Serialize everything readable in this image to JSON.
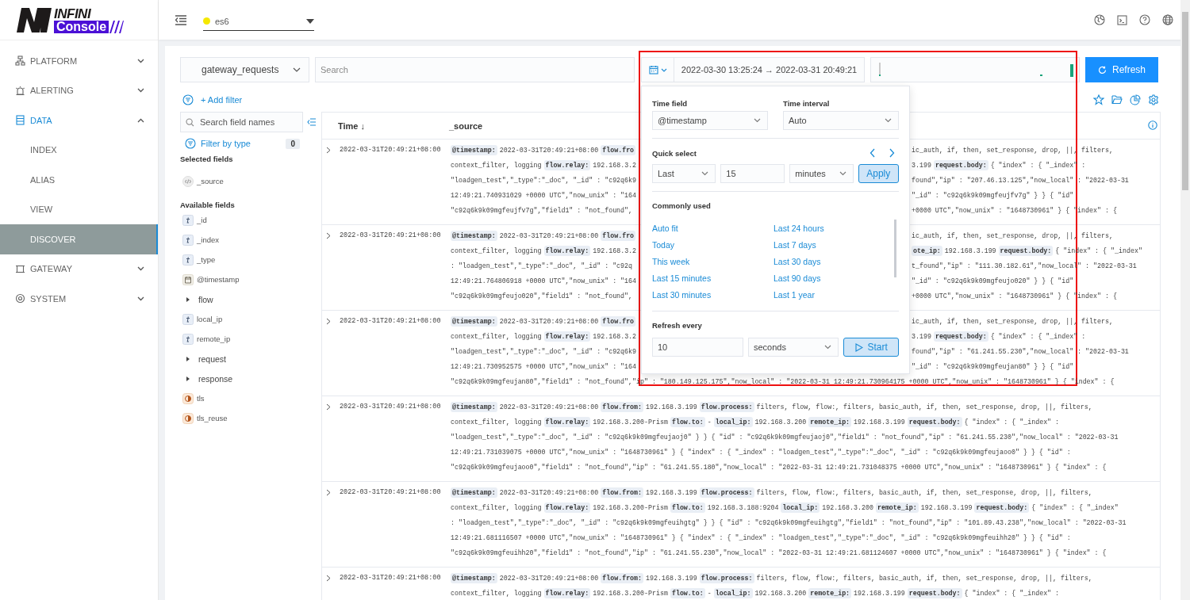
{
  "logo": {
    "brand": "INFINI",
    "product": "Console"
  },
  "nav": [
    {
      "label": "PLATFORM",
      "selected": false,
      "expanded": false
    },
    {
      "label": "ALERTING",
      "selected": false,
      "expanded": false
    },
    {
      "label": "DATA",
      "selected": true,
      "expanded": true,
      "children": [
        {
          "label": "INDEX",
          "selected": false
        },
        {
          "label": "ALIAS",
          "selected": false
        },
        {
          "label": "VIEW",
          "selected": false
        },
        {
          "label": "DISCOVER",
          "selected": true
        }
      ]
    },
    {
      "label": "GATEWAY",
      "selected": false,
      "expanded": false
    },
    {
      "label": "SYSTEM",
      "selected": false,
      "expanded": false
    }
  ],
  "cluster": {
    "name": "es6",
    "color": "#f5e800"
  },
  "toolbar": {
    "index": "gateway_requests",
    "search_placeholder": "Search",
    "time_range": "2022-03-30 13:25:24 → 2022-03-31 20:49:21",
    "refresh": "Refresh",
    "add_filter": "+ Add filter"
  },
  "fields": {
    "search_placeholder": "Search field names",
    "filter_label": "Filter by type",
    "filter_count": "0",
    "selected_title": "Selected fields",
    "selected": [
      {
        "name": "_source",
        "kind": "source"
      }
    ],
    "available_title": "Available fields",
    "available": [
      {
        "name": "_id",
        "kind": "string"
      },
      {
        "name": "_index",
        "kind": "string"
      },
      {
        "name": "_type",
        "kind": "string"
      },
      {
        "name": "@timestamp",
        "kind": "date"
      },
      {
        "name": "flow",
        "kind": "group"
      },
      {
        "name": "local_ip",
        "kind": "string"
      },
      {
        "name": "remote_ip",
        "kind": "string"
      },
      {
        "name": "request",
        "kind": "group"
      },
      {
        "name": "response",
        "kind": "group"
      },
      {
        "name": "tls",
        "kind": "boolean"
      },
      {
        "name": "tls_reuse",
        "kind": "boolean"
      }
    ]
  },
  "table": {
    "columns": [
      "Time ↓",
      "_source"
    ],
    "rows": [
      {
        "time": "2022-03-31T20:49:21+08:00",
        "lines": [
          {
            "kind": "split",
            "left": [
              {
                "key": "@timestamp:"
              },
              {
                "value": "2022-03-31T20:49:21+08:00"
              },
              {
                "key": "flow.fro"
              }
            ],
            "right": [
              {
                "value": "ic_auth, if, then, set_response, drop, ||, filters,"
              }
            ]
          },
          {
            "kind": "split",
            "left": [
              {
                "value": "context_filter, logging"
              },
              {
                "key": "flow.relay:"
              },
              {
                "value": "192.168.3.2"
              }
            ],
            "right": [
              {
                "value": "3.199"
              },
              {
                "key": "request.body:"
              },
              {
                "value": "{ \"index\" : { \"_index\" :"
              }
            ]
          },
          {
            "kind": "split",
            "left": [
              {
                "value": "\"loadgen_test\",\"_type\":\"_doc\", \"_id\" : \"c92q6k9"
              }
            ],
            "right": [
              {
                "value": "found\",\"ip\" : \"207.46.13.125\",\"now_local\" : \"2022-03-31"
              }
            ]
          },
          {
            "kind": "split",
            "left": [
              {
                "value": "12:49:21.740931029 +0000 UTC\",\"now_unix\" : \"164"
              }
            ],
            "right": [
              {
                "value": "\"_id\" : \"c92q6k9k09mgfeujfv7g\" } } { \"id\""
              }
            ]
          },
          {
            "kind": "split",
            "left": [
              {
                "value": "\"c92q6k9k09mgfeujfv7g\",\"field1\" : \"not_found\","
              }
            ],
            "right": [
              {
                "value": "+0000 UTC\",\"now_unix\" : \"1648730961\" } { \"index\" : {"
              }
            ]
          }
        ]
      },
      {
        "time": "2022-03-31T20:49:21+08:00",
        "lines": [
          {
            "kind": "split",
            "left": [
              {
                "key": "@timestamp:"
              },
              {
                "value": "2022-03-31T20:49:21+08:00"
              },
              {
                "key": "flow.fro"
              }
            ],
            "right": [
              {
                "value": "ic_auth, if, then, set_response, drop, ||, filters,"
              }
            ]
          },
          {
            "kind": "split",
            "left": [
              {
                "value": "context_filter, logging"
              },
              {
                "key": "flow.relay:"
              },
              {
                "value": "192.168.3.2"
              }
            ],
            "right": [
              {
                "key": "ote_ip:"
              },
              {
                "value": "192.168.3.199"
              },
              {
                "key": "request.body:"
              },
              {
                "value": "{ \"index\" : { \"_index\""
              }
            ]
          },
          {
            "kind": "split",
            "left": [
              {
                "value": ": \"loadgen_test\",\"_type\":\"_doc\", \"_id\" : \"c92q"
              }
            ],
            "right": [
              {
                "value": "t_found\",\"ip\" : \"111.30.182.61\",\"now_local\" : \"2022-03-31"
              }
            ]
          },
          {
            "kind": "split",
            "left": [
              {
                "value": "12:49:21.764806918 +0000 UTC\",\"now_unix\" : \"164"
              }
            ],
            "right": [
              {
                "value": "\"_id\" : \"c92q6k9k09mgfeujo020\" } } { \"id\""
              }
            ]
          },
          {
            "kind": "split",
            "left": [
              {
                "value": "\"c92q6k9k09mgfeujo020\",\"field1\" : \"not_found\","
              }
            ],
            "right": [
              {
                "value": "+0000 UTC\",\"now_unix\" : \"1648730961\" } { \"index\" : {"
              }
            ]
          }
        ]
      },
      {
        "time": "2022-03-31T20:49:21+08:00",
        "lines": [
          {
            "kind": "split",
            "left": [
              {
                "key": "@timestamp:"
              },
              {
                "value": "2022-03-31T20:49:21+08:00"
              },
              {
                "key": "flow.fro"
              }
            ],
            "right": [
              {
                "value": "ic_auth, if, then, set_response, drop, ||, filters,"
              }
            ]
          },
          {
            "kind": "split",
            "left": [
              {
                "value": "context_filter, logging"
              },
              {
                "key": "flow.relay:"
              },
              {
                "value": "192.168.3.2"
              }
            ],
            "right": [
              {
                "value": "3.199"
              },
              {
                "key": "request.body:"
              },
              {
                "value": "{ \"index\" : { \"_index\" :"
              }
            ]
          },
          {
            "kind": "split",
            "left": [
              {
                "value": "\"loadgen_test\",\"_type\":\"_doc\", \"_id\" : \"c92q6k9"
              }
            ],
            "right": [
              {
                "value": "found\",\"ip\" : \"61.241.55.230\",\"now_local\" : \"2022-03-31"
              }
            ]
          },
          {
            "kind": "split",
            "left": [
              {
                "value": "12:49:21.730952575 +0000 UTC\",\"now_unix\" : \"164"
              }
            ],
            "right": [
              {
                "value": "\"_id\" : \"c92q6k9k09mgfeujan80\" } } { \"id\""
              }
            ]
          },
          {
            "kind": "full",
            "segments": [
              {
                "value": "\"c92q6k9k09mgfeujan80\",\"field1\" : \"not_found\",\"ip\" : \"180.149.125.175\",\"now_local\" : \"2022-03-31 12:49:21.730964175 +0000 UTC\",\"now_unix\" : \"1648730961\" } { \"index\" : {"
              }
            ]
          }
        ]
      },
      {
        "time": "2022-03-31T20:49:21+08:00",
        "lines": [
          {
            "kind": "full",
            "segments": [
              {
                "key": "@timestamp:"
              },
              {
                "value": "2022-03-31T20:49:21+08:00"
              },
              {
                "key": "flow.from:"
              },
              {
                "value": "192.168.3.199"
              },
              {
                "key": "flow.process:"
              },
              {
                "value": "filters, flow, flow:, filters, basic_auth, if, then, set_response, drop, ||, filters,"
              }
            ]
          },
          {
            "kind": "full",
            "segments": [
              {
                "value": "context_filter, logging"
              },
              {
                "key": "flow.relay:"
              },
              {
                "value": "192.168.3.200-Prism"
              },
              {
                "key": "flow.to:"
              },
              {
                "value": "-"
              },
              {
                "key": "local_ip:"
              },
              {
                "value": "192.168.3.200"
              },
              {
                "key": "remote_ip:"
              },
              {
                "value": "192.168.3.199"
              },
              {
                "key": "request.body:"
              },
              {
                "value": "{ \"index\" : { \"_index\" :"
              }
            ]
          },
          {
            "kind": "full",
            "segments": [
              {
                "value": "\"loadgen_test\",\"_type\":\"_doc\", \"_id\" : \"c92q6k9k09mgfeujaoj0\" } } { \"id\" : \"c92q6k9k09mgfeujaoj0\",\"field1\" : \"not_found\",\"ip\" : \"61.241.55.230\",\"now_local\" : \"2022-03-31"
              }
            ]
          },
          {
            "kind": "full",
            "segments": [
              {
                "value": "12:49:21.731039075 +0000 UTC\",\"now_unix\" : \"1648730961\" } { \"index\" : { \"_index\" : \"loadgen_test\",\"_type\":\"_doc\", \"_id\" : \"c92q6k9k09mgfeujaoo0\" } } { \"id\" :"
              }
            ]
          },
          {
            "kind": "full",
            "segments": [
              {
                "value": "\"c92q6k9k09mgfeujaoo0\",\"field1\" : \"not_found\",\"ip\" : \"61.241.55.180\",\"now_local\" : \"2022-03-31 12:49:21.731048375 +0000 UTC\",\"now_unix\" : \"1648730961\" } { \"index\" : {"
              }
            ]
          }
        ]
      },
      {
        "time": "2022-03-31T20:49:21+08:00",
        "lines": [
          {
            "kind": "full",
            "segments": [
              {
                "key": "@timestamp:"
              },
              {
                "value": "2022-03-31T20:49:21+08:00"
              },
              {
                "key": "flow.from:"
              },
              {
                "value": "192.168.3.199"
              },
              {
                "key": "flow.process:"
              },
              {
                "value": "filters, flow, flow:, filters, basic_auth, if, then, set_response, drop, ||, filters,"
              }
            ]
          },
          {
            "kind": "full",
            "segments": [
              {
                "value": "context_filter, logging"
              },
              {
                "key": "flow.relay:"
              },
              {
                "value": "192.168.3.200-Prism"
              },
              {
                "key": "flow.to:"
              },
              {
                "value": "192.168.3.188:9204"
              },
              {
                "key": "local_ip:"
              },
              {
                "value": "192.168.3.200"
              },
              {
                "key": "remote_ip:"
              },
              {
                "value": "192.168.3.199"
              },
              {
                "key": "request.body:"
              },
              {
                "value": "{ \"index\" : { \"_index\""
              }
            ]
          },
          {
            "kind": "full",
            "segments": [
              {
                "value": ": \"loadgen_test\",\"_type\":\"_doc\", \"_id\" : \"c92q6k9k09mgfeuihgtg\" } } { \"id\" : \"c92q6k9k09mgfeuihgtg\",\"field1\" : \"not_found\",\"ip\" : \"101.89.43.238\",\"now_local\" : \"2022-03-31"
              }
            ]
          },
          {
            "kind": "full",
            "segments": [
              {
                "value": "12:49:21.681116507 +0000 UTC\",\"now_unix\" : \"1648730961\" } { \"index\" : { \"_index\" : \"loadgen_test\",\"_type\":\"_doc\", \"_id\" : \"c92q6k9k09mgfeuihh20\" } } { \"id\" :"
              }
            ]
          },
          {
            "kind": "full",
            "segments": [
              {
                "value": "\"c92q6k9k09mgfeuihh20\",\"field1\" : \"not_found\",\"ip\" : \"61.241.55.230\",\"now_local\" : \"2022-03-31 12:49:21.681124607 +0000 UTC\",\"now_unix\" : \"1648730961\" } { \"index\" : {"
              }
            ]
          }
        ]
      },
      {
        "time": "2022-03-31T20:49:21+08:00",
        "lines": [
          {
            "kind": "full",
            "segments": [
              {
                "key": "@timestamp:"
              },
              {
                "value": "2022-03-31T20:49:21+08:00"
              },
              {
                "key": "flow.from:"
              },
              {
                "value": "192.168.3.199"
              },
              {
                "key": "flow.process:"
              },
              {
                "value": "filters, flow, flow:, filters, basic_auth, if, then, set_response, drop, ||, filters,"
              }
            ]
          },
          {
            "kind": "full",
            "segments": [
              {
                "value": "context_filter, logging"
              },
              {
                "key": "flow.relay:"
              },
              {
                "value": "192.168.3.200-Prism"
              },
              {
                "key": "flow.to:"
              },
              {
                "value": "-"
              },
              {
                "key": "local_ip:"
              },
              {
                "value": "192.168.3.200"
              },
              {
                "key": "remote_ip:"
              },
              {
                "value": "192.168.3.199"
              },
              {
                "key": "request.body:"
              },
              {
                "value": "{ \"index\" : { \"_index\" :"
              }
            ]
          }
        ]
      }
    ]
  },
  "popover": {
    "time_field": {
      "label": "Time field",
      "value": "@timestamp"
    },
    "time_interval": {
      "label": "Time interval",
      "value": "Auto"
    },
    "quick_select": {
      "title": "Quick select",
      "direction": "Last",
      "amount": "15",
      "unit": "minutes",
      "apply": "Apply"
    },
    "commonly_used": {
      "title": "Commonly used",
      "items": [
        "Auto fit",
        "Today",
        "This week",
        "Last 15 minutes",
        "Last 30 minutes",
        "Last 24 hours",
        "Last 7 days",
        "Last 30 days",
        "Last 90 days",
        "Last 1 year"
      ]
    },
    "refresh": {
      "title": "Refresh every",
      "amount": "10",
      "unit": "seconds",
      "start": "Start"
    }
  }
}
